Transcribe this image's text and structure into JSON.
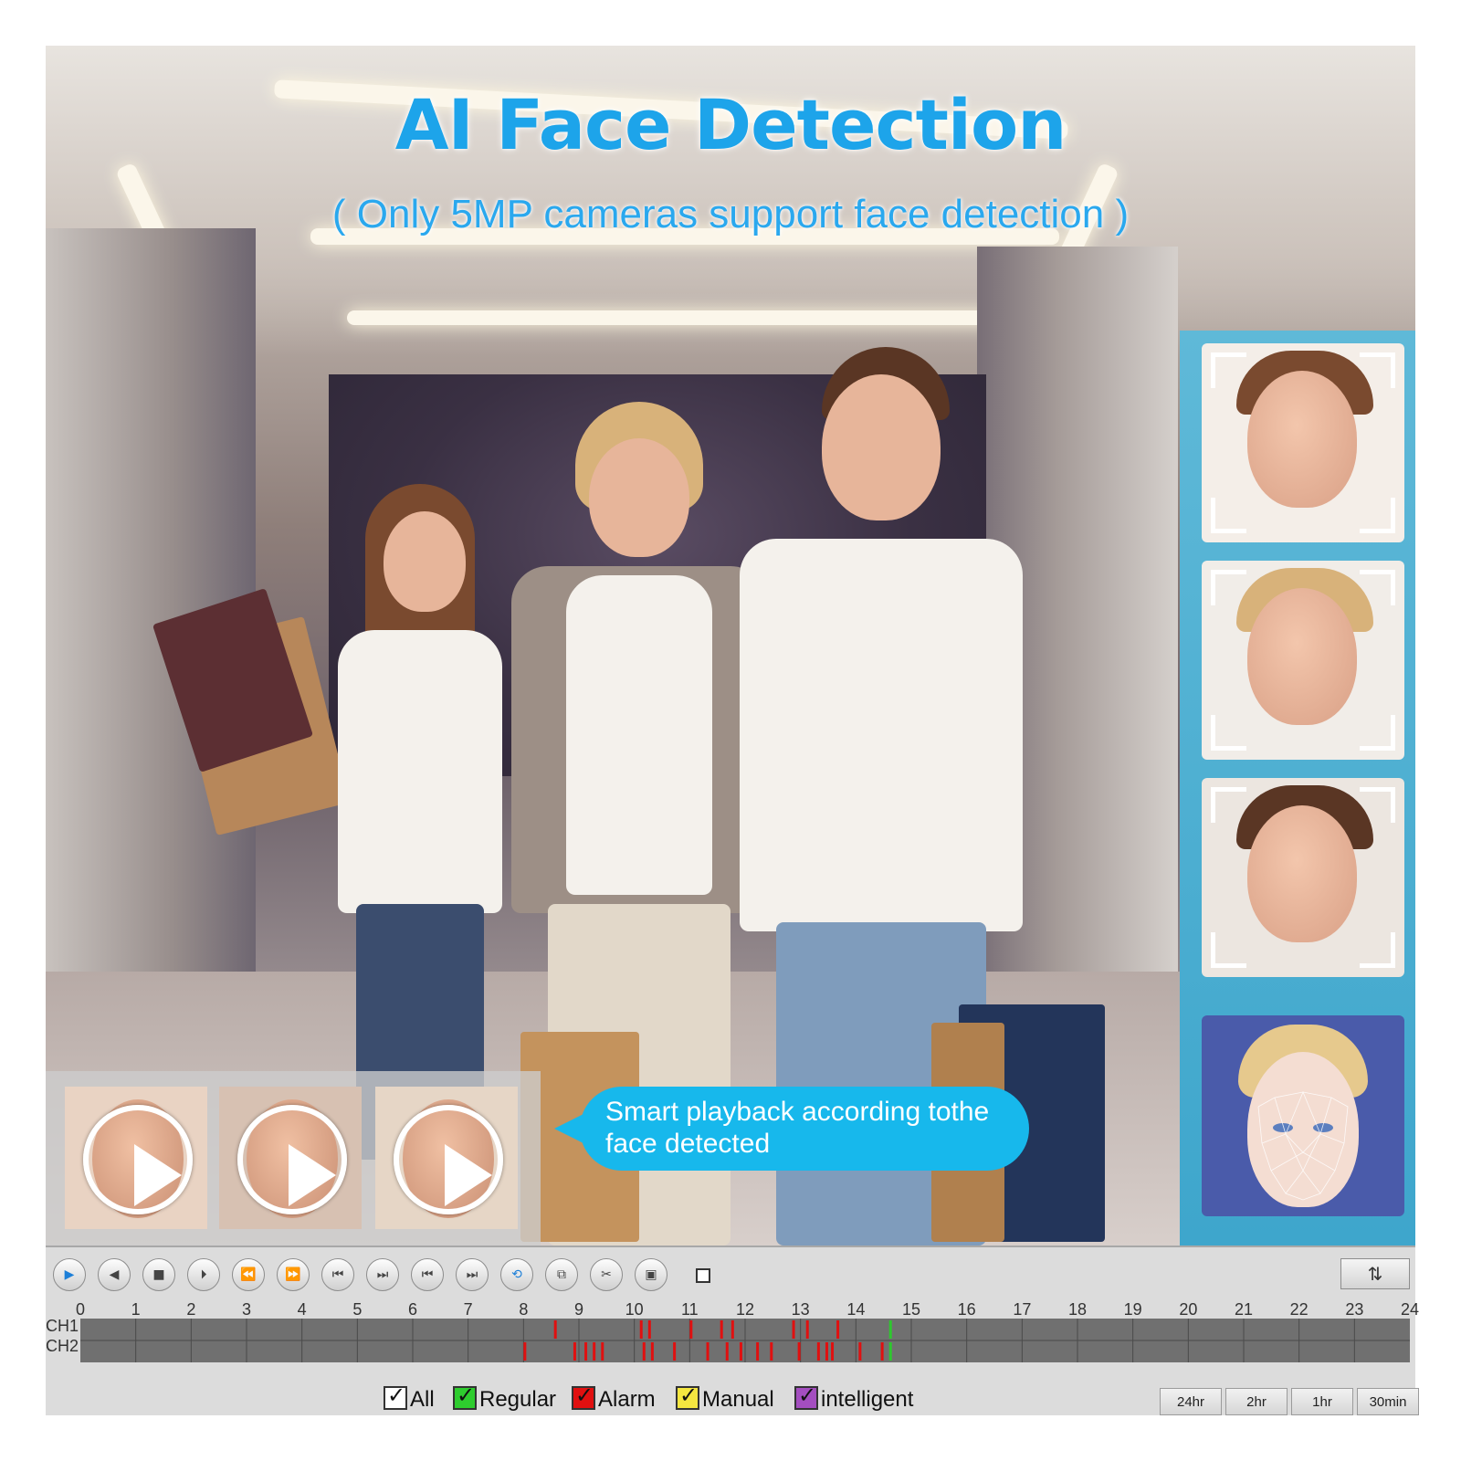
{
  "banner": {
    "title": "AI Face Detection",
    "subtitle": "( Only 5MP cameras support face detection )"
  },
  "bubble": {
    "line1": "Smart playback according tothe",
    "line2": "face detected"
  },
  "face_panel": {
    "cards": [
      {
        "name": "girl-face"
      },
      {
        "name": "woman-face"
      },
      {
        "name": "man-face"
      },
      {
        "name": "ai-face-mesh"
      }
    ]
  },
  "thumbnails": [
    {
      "name": "girl-clip"
    },
    {
      "name": "man-clip"
    },
    {
      "name": "woman-clip"
    }
  ],
  "controls": [
    {
      "icon": "play-icon",
      "glyph": "▶"
    },
    {
      "icon": "reverse-play-icon",
      "glyph": "◀"
    },
    {
      "icon": "stop-icon",
      "glyph": "■"
    },
    {
      "icon": "pause-step-icon",
      "glyph": "⏵"
    },
    {
      "icon": "rewind-icon",
      "glyph": "⏪"
    },
    {
      "icon": "fast-forward-icon",
      "glyph": "⏩"
    },
    {
      "icon": "frame-back-icon",
      "glyph": "⏮"
    },
    {
      "icon": "frame-forward-icon",
      "glyph": "⏭"
    },
    {
      "icon": "skip-back-icon",
      "glyph": "⏮"
    },
    {
      "icon": "skip-forward-icon",
      "glyph": "⏭"
    },
    {
      "icon": "loop-icon",
      "glyph": "⟲"
    },
    {
      "icon": "copy-icon",
      "glyph": "⧉"
    },
    {
      "icon": "clip-cut-icon",
      "glyph": "✂"
    },
    {
      "icon": "save-icon",
      "glyph": "▣"
    }
  ],
  "timeline": {
    "hours": [
      "0",
      "1",
      "2",
      "3",
      "4",
      "5",
      "6",
      "7",
      "8",
      "9",
      "10",
      "11",
      "12",
      "13",
      "14",
      "15",
      "16",
      "17",
      "18",
      "19",
      "20",
      "21",
      "22",
      "23",
      "24"
    ],
    "channels": [
      "CH1",
      "CH2"
    ],
    "events": [
      {
        "hour": 8.0,
        "ch": 2,
        "type": "alarm"
      },
      {
        "hour": 8.55,
        "ch": 1,
        "type": "alarm"
      },
      {
        "hour": 8.9,
        "ch": 2,
        "type": "alarm"
      },
      {
        "hour": 9.1,
        "ch": 2,
        "type": "alarm"
      },
      {
        "hour": 9.25,
        "ch": 2,
        "type": "alarm"
      },
      {
        "hour": 9.4,
        "ch": 2,
        "type": "alarm"
      },
      {
        "hour": 10.1,
        "ch": 1,
        "type": "alarm"
      },
      {
        "hour": 10.15,
        "ch": 2,
        "type": "alarm"
      },
      {
        "hour": 10.25,
        "ch": 1,
        "type": "alarm"
      },
      {
        "hour": 10.3,
        "ch": 2,
        "type": "alarm"
      },
      {
        "hour": 10.7,
        "ch": 2,
        "type": "alarm"
      },
      {
        "hour": 11.0,
        "ch": 1,
        "type": "alarm"
      },
      {
        "hour": 11.3,
        "ch": 2,
        "type": "alarm"
      },
      {
        "hour": 11.55,
        "ch": 1,
        "type": "alarm"
      },
      {
        "hour": 11.65,
        "ch": 2,
        "type": "alarm"
      },
      {
        "hour": 11.75,
        "ch": 1,
        "type": "alarm"
      },
      {
        "hour": 11.9,
        "ch": 2,
        "type": "alarm"
      },
      {
        "hour": 12.2,
        "ch": 2,
        "type": "alarm"
      },
      {
        "hour": 12.45,
        "ch": 2,
        "type": "alarm"
      },
      {
        "hour": 12.85,
        "ch": 1,
        "type": "alarm"
      },
      {
        "hour": 12.95,
        "ch": 2,
        "type": "alarm"
      },
      {
        "hour": 13.1,
        "ch": 1,
        "type": "alarm"
      },
      {
        "hour": 13.3,
        "ch": 2,
        "type": "alarm"
      },
      {
        "hour": 13.45,
        "ch": 2,
        "type": "alarm"
      },
      {
        "hour": 13.55,
        "ch": 2,
        "type": "alarm"
      },
      {
        "hour": 13.65,
        "ch": 1,
        "type": "alarm"
      },
      {
        "hour": 14.05,
        "ch": 2,
        "type": "alarm"
      },
      {
        "hour": 14.45,
        "ch": 2,
        "type": "alarm"
      },
      {
        "hour": 14.6,
        "ch": 1,
        "type": "regular"
      },
      {
        "hour": 14.6,
        "ch": 2,
        "type": "regular"
      }
    ],
    "colors": {
      "alarm": "#e01010",
      "regular": "#2ec82e",
      "bg": "#707070",
      "grid": "#4a4a4a"
    }
  },
  "legend": [
    {
      "label": "All",
      "color": "#ffffff"
    },
    {
      "label": "Regular",
      "color": "#2ecc2e"
    },
    {
      "label": "Alarm",
      "color": "#e11010"
    },
    {
      "label": "Manual",
      "color": "#f4e640"
    },
    {
      "label": "intelligent",
      "color": "#a44ec0"
    }
  ],
  "zoom": [
    "24hr",
    "2hr",
    "1hr",
    "30min"
  ],
  "swap_glyph": "⇅"
}
